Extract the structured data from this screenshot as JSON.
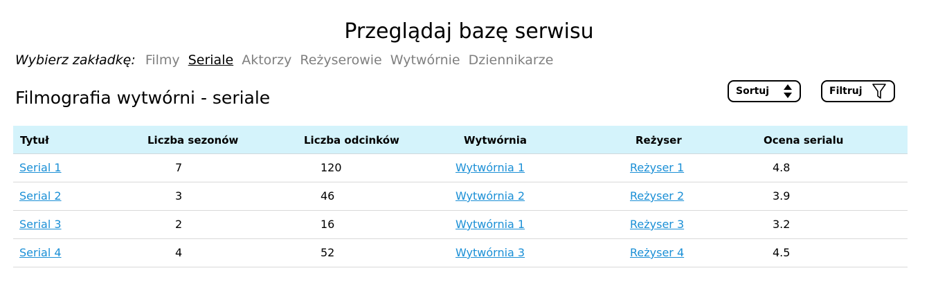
{
  "page": {
    "title": "Przeglądaj bazę serwisu"
  },
  "tabs": {
    "label": "Wybierz zakładkę:",
    "items": [
      {
        "label": "Filmy",
        "active": false
      },
      {
        "label": "Seriale",
        "active": true
      },
      {
        "label": "Aktorzy",
        "active": false
      },
      {
        "label": "Reżyserowie",
        "active": false
      },
      {
        "label": "Wytwórnie",
        "active": false
      },
      {
        "label": "Dziennikarze",
        "active": false
      }
    ]
  },
  "section": {
    "title": "Filmografia wytwórni - seriale"
  },
  "toolbar": {
    "sort_label": "Sortuj",
    "filter_label": "Filtruj",
    "sort_icon": "sort-arrows-icon",
    "filter_icon": "funnel-icon"
  },
  "table": {
    "columns": [
      "Tytuł",
      "Liczba sezonów",
      "Liczba odcinków",
      "Wytwórnia",
      "Reżyser",
      "Ocena serialu"
    ],
    "rows": [
      {
        "title": "Serial 1",
        "seasons": "7",
        "episodes": "120",
        "studio": "Wytwórnia 1",
        "director": "Reżyser 1",
        "rating": "4.8"
      },
      {
        "title": "Serial 2",
        "seasons": "3",
        "episodes": "46",
        "studio": "Wytwórnia 2",
        "director": "Reżyser 2",
        "rating": "3.9"
      },
      {
        "title": "Serial 3",
        "seasons": "2",
        "episodes": "16",
        "studio": "Wytwórnia 1",
        "director": "Reżyser 3",
        "rating": "3.2"
      },
      {
        "title": "Serial 4",
        "seasons": "4",
        "episodes": "52",
        "studio": "Wytwórnia 3",
        "director": "Reżyser 4",
        "rating": "4.5"
      }
    ]
  },
  "colors": {
    "header_background": "#d4f3fb",
    "link": "#1a8fd6",
    "inactive_tab": "#7f7f7f"
  }
}
